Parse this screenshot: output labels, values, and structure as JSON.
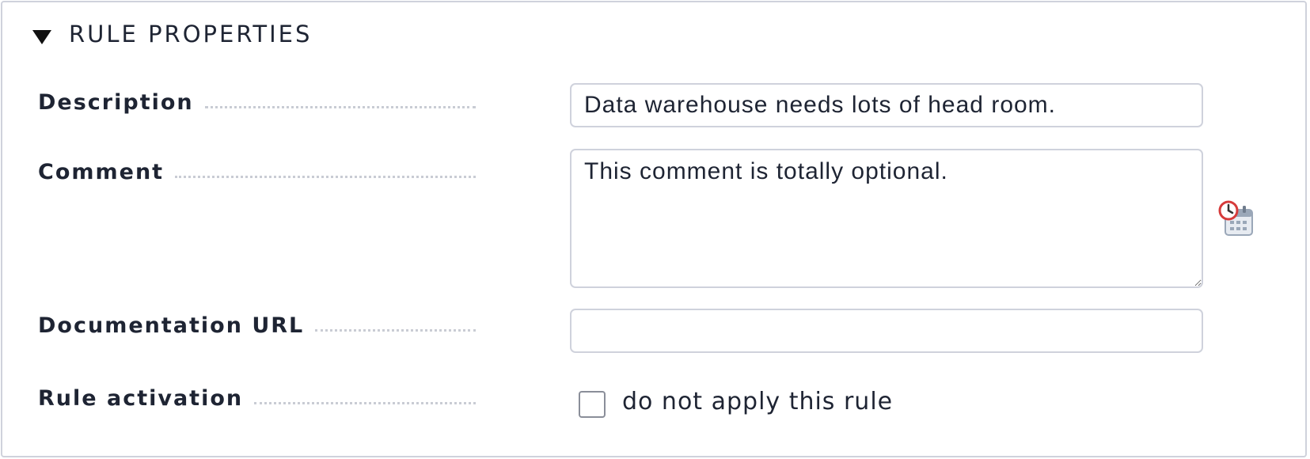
{
  "section": {
    "title": "RULE PROPERTIES",
    "toggle_icon": "triangle-down-icon"
  },
  "fields": {
    "description": {
      "label": "Description",
      "value": "Data warehouse needs lots of head room."
    },
    "comment": {
      "label": "Comment",
      "value": "This comment is totally optional.",
      "action_icon": "clock-calendar-icon"
    },
    "documentation_url": {
      "label": "Documentation URL",
      "value": ""
    },
    "rule_activation": {
      "label": "Rule activation",
      "checkbox_label": "do not apply this rule",
      "checked": false
    }
  },
  "colors": {
    "text": "#1e2433",
    "border": "#cfd2dc",
    "leader": "#c9ccd4",
    "clock_accent": "#d63b3b",
    "calendar": "#9aa7b8"
  }
}
